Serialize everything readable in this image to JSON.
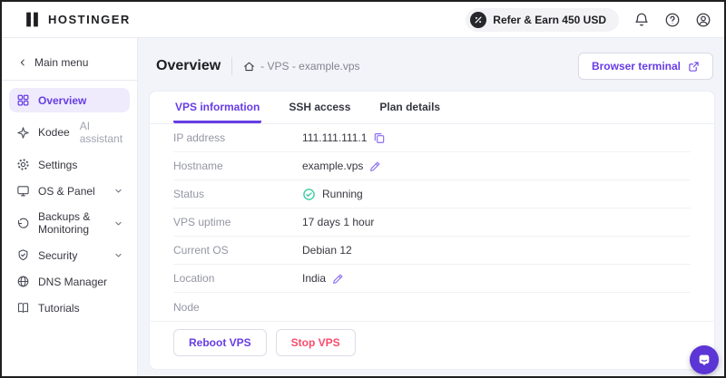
{
  "topbar": {
    "brand": "HOSTINGER",
    "refer_button_label": "Refer & Earn 450 USD"
  },
  "sidebar": {
    "back_label": "Main menu",
    "items": [
      {
        "label": "Overview"
      },
      {
        "label": "Kodee",
        "suffix": "AI assistant"
      },
      {
        "label": "Settings"
      },
      {
        "label": "OS & Panel"
      },
      {
        "label": "Backups & Monitoring"
      },
      {
        "label": "Security"
      },
      {
        "label": "DNS Manager"
      },
      {
        "label": "Tutorials"
      }
    ]
  },
  "header": {
    "title": "Overview",
    "breadcrumb": "- VPS - example.vps",
    "terminal_button_label": "Browser terminal"
  },
  "tabs": [
    {
      "label": "VPS information",
      "active": true
    },
    {
      "label": "SSH access",
      "active": false
    },
    {
      "label": "Plan details",
      "active": false
    }
  ],
  "vps_info": {
    "rows": [
      {
        "label": "IP address",
        "value": "111.111.111.1",
        "action": "copy"
      },
      {
        "label": "Hostname",
        "value": "example.vps",
        "action": "edit"
      },
      {
        "label": "Status",
        "value": "Running",
        "status": "running"
      },
      {
        "label": "VPS uptime",
        "value": "17 days 1 hour"
      },
      {
        "label": "Current OS",
        "value": "Debian 12"
      },
      {
        "label": "Location",
        "value": "India",
        "action": "edit"
      },
      {
        "label": "Node",
        "value": ""
      }
    ],
    "buttons": [
      {
        "label": "Reboot VPS",
        "variant": "purple"
      },
      {
        "label": "Stop VPS",
        "variant": "danger"
      }
    ]
  },
  "colors": {
    "brand_purple": "#673de6",
    "active_item_bg": "#efebfc",
    "success_green": "#00b090",
    "danger_red": "#fc4b6c",
    "main_bg": "#f3f4fa"
  }
}
